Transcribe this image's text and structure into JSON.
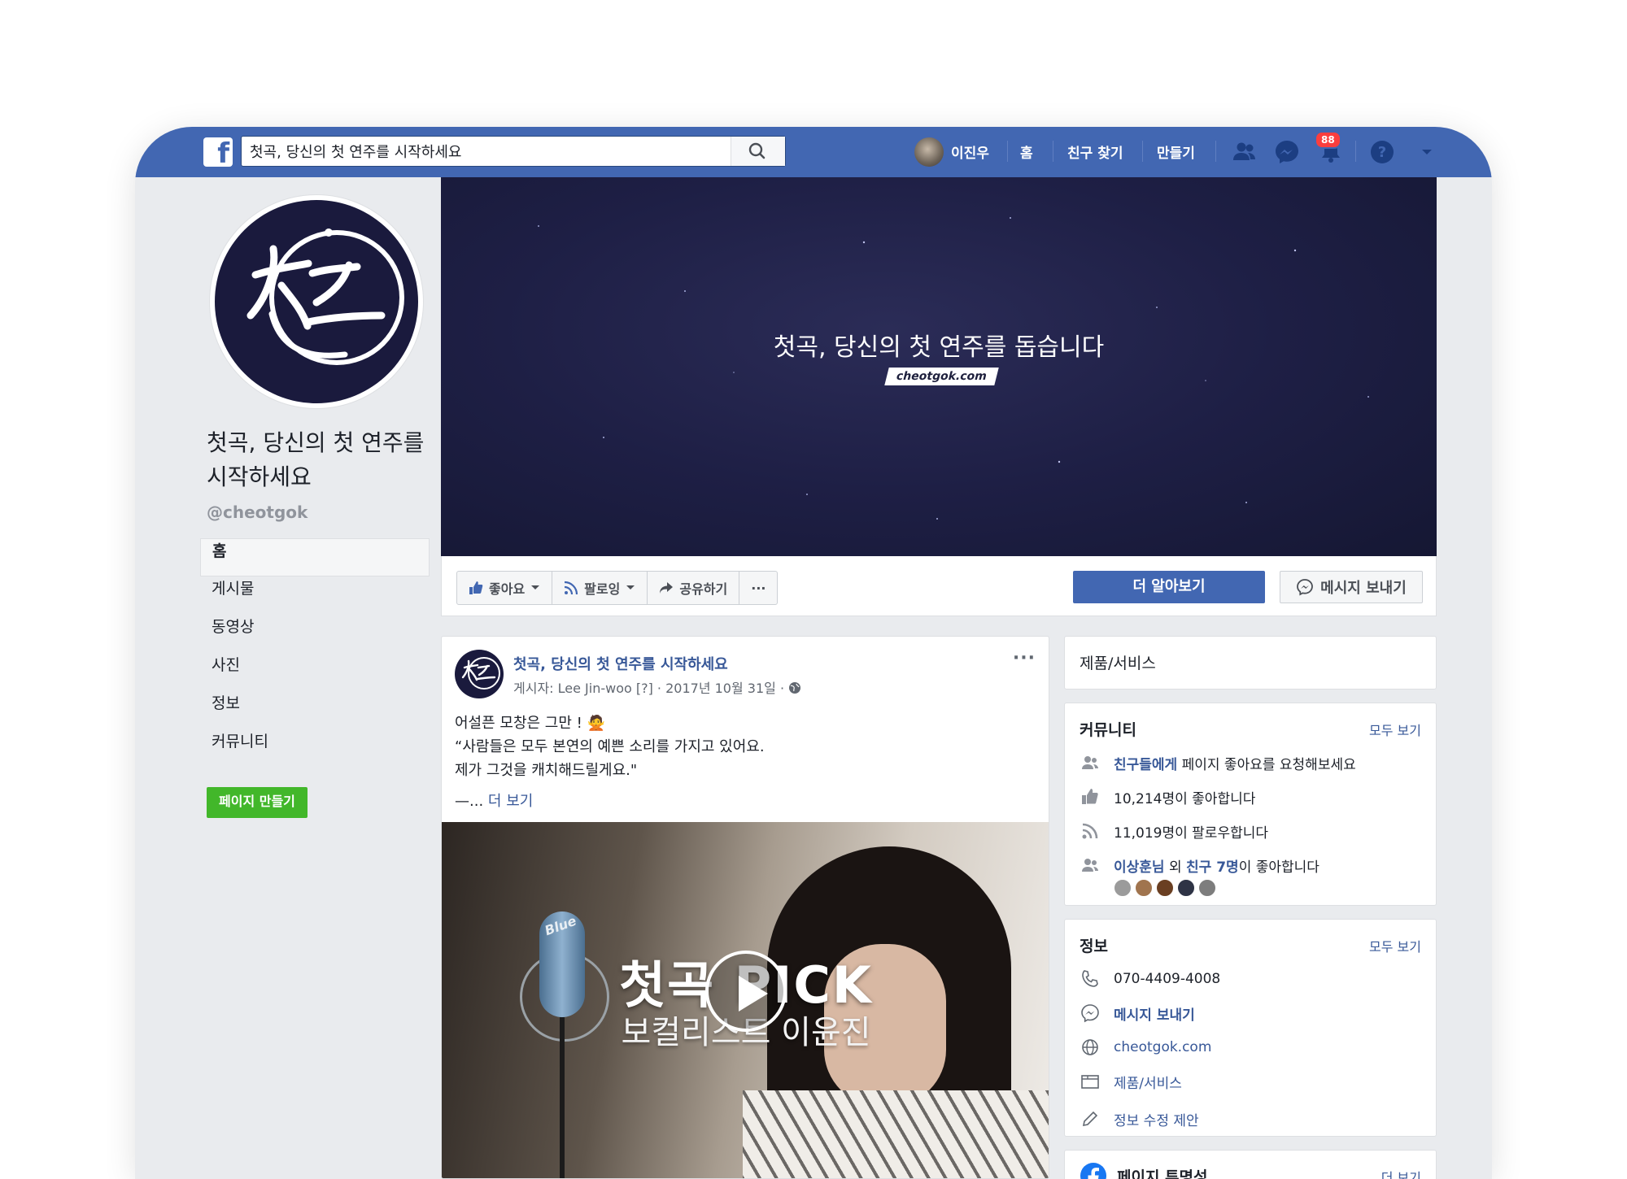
{
  "topbar": {
    "fb_logo": "f",
    "search_value": "첫곡, 당신의 첫 연주를 시작하세요",
    "user_name": "이진우",
    "home": "홈",
    "find_friends": "친구 찾기",
    "create": "만들기",
    "notifications_count": "88"
  },
  "page": {
    "title": "첫곡, 당신의 첫 연주를 시작하세요",
    "handle": "@cheotgok",
    "nav": [
      "홈",
      "게시물",
      "동영상",
      "사진",
      "정보",
      "커뮤니티"
    ],
    "create_page": "페이지 만들기"
  },
  "cover": {
    "title": "첫곡, 당신의 첫 연주를 돕습니다",
    "url": "cheotgok.com"
  },
  "actions": {
    "like": "좋아요",
    "follow": "팔로잉",
    "share": "공유하기",
    "more": "···",
    "learn_more": "더 알아보기",
    "message": "메시지 보내기"
  },
  "post": {
    "author": "첫곡, 당신의 첫 연주를 시작하세요",
    "meta": "게시자: Lee Jin-woo [?] · 2017년 10월 31일 ·",
    "more": "···",
    "line1": "어설픈 모창은 그만 ! 🙅",
    "line2": "“사람들은 모두 본연의 예쁜 소리를 가지고 있어요.",
    "line3": "제가 그것을 캐치해드릴게요.\"",
    "see_more_prefix": "—...",
    "see_more": "더 보기",
    "video_title": "첫곡 PICK",
    "video_subtitle": "보컬리스트 이윤진",
    "mic_brand": "Blue"
  },
  "products_card": {
    "title": "제품/서비스"
  },
  "community_card": {
    "title": "커뮤니티",
    "see_all": "모두 보기",
    "invite_link": "친구들에게",
    "invite_text": "페이지 좋아요를 요청해보세요",
    "likes": "10,214명이 좋아합니다",
    "follows": "11,019명이 팔로우합니다",
    "friend_name": "이상훈님",
    "friend_mid": " 외 ",
    "friend_count": "친구 7명",
    "friend_suffix": "이 좋아합니다"
  },
  "info_card": {
    "title": "정보",
    "see_all": "모두 보기",
    "phone": "070-4409-4008",
    "message": "메시지 보내기",
    "website": "cheotgok.com",
    "products": "제품/서비스",
    "suggest_edit": "정보 수정 제안"
  },
  "transparency_card": {
    "title": "페이지 투명성",
    "see_more": "더 보기"
  },
  "colors": {
    "brand": "#4267b2",
    "link": "#385898",
    "background": "#e9ebee",
    "create_button": "#42b72a",
    "notification": "#fa3e3e"
  }
}
